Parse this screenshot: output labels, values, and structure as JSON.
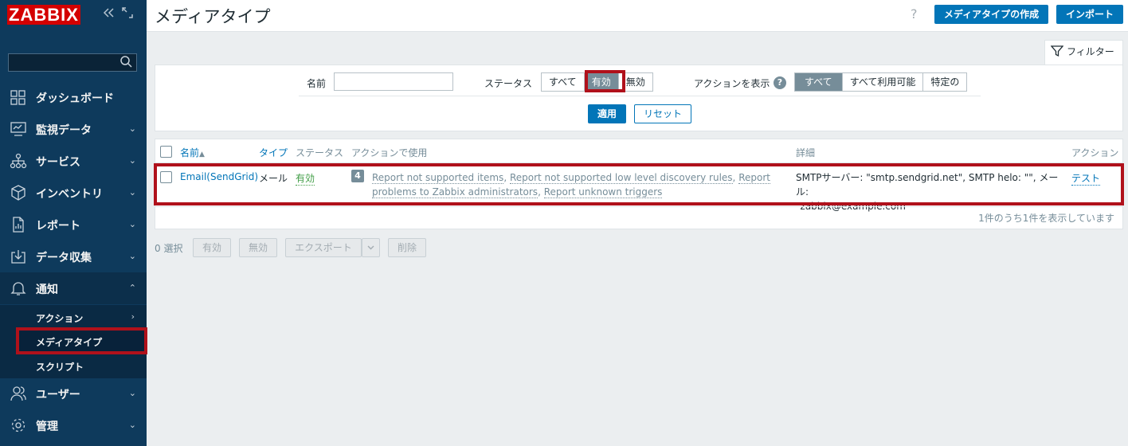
{
  "app": {
    "logo": "ZABBIX"
  },
  "sidebar": {
    "items": [
      {
        "label": "ダッシュボード",
        "icon": "dashboard-icon"
      },
      {
        "label": "監視データ",
        "icon": "monitoring-icon"
      },
      {
        "label": "サービス",
        "icon": "services-icon"
      },
      {
        "label": "インベントリ",
        "icon": "inventory-icon"
      },
      {
        "label": "レポート",
        "icon": "reports-icon"
      },
      {
        "label": "データ収集",
        "icon": "data-collection-icon"
      },
      {
        "label": "通知",
        "icon": "bell-icon"
      },
      {
        "label": "ユーザー",
        "icon": "users-icon"
      },
      {
        "label": "管理",
        "icon": "gear-icon"
      }
    ],
    "submenu": [
      {
        "label": "アクション"
      },
      {
        "label": "メディアタイプ"
      },
      {
        "label": "スクリプト"
      }
    ]
  },
  "header": {
    "title": "メディアタイプ",
    "help": "?",
    "create_label": "メディアタイプの作成",
    "import_label": "インポート"
  },
  "filter": {
    "tab_label": "フィルター",
    "name_label": "名前",
    "name_value": "",
    "status_label": "ステータス",
    "status_options": [
      "すべて",
      "有効",
      "無効"
    ],
    "status_selected": "有効",
    "actions_label": "アクションを表示",
    "actions_help": "?",
    "actions_options": [
      "すべて",
      "すべて利用可能",
      "特定の"
    ],
    "actions_selected": "すべて",
    "apply_label": "適用",
    "reset_label": "リセット"
  },
  "table": {
    "columns": {
      "name": "名前",
      "sort_arrow": "▲",
      "type": "タイプ",
      "status": "ステータス",
      "used_in_actions": "アクションで使用",
      "details": "詳細",
      "actions": "アクション"
    },
    "rows": [
      {
        "name": "Email(SendGrid)",
        "type": "メール",
        "status": "有効",
        "action_count": "4",
        "actions": [
          "Report not supported items",
          "Report not supported low level discovery rules",
          "Report problems to Zabbix administrators",
          "Report unknown triggers"
        ],
        "details_line1": "SMTPサーバー: \"smtp.sendgrid.net\", SMTP helo: \"\", メール:",
        "details_line2": "\"zabbix@example.com\"",
        "test_label": "テスト"
      }
    ],
    "footer": "1件のうち1件を表示しています"
  },
  "bottom_bar": {
    "selected": "0 選択",
    "enable_label": "有効",
    "disable_label": "無効",
    "export_label": "エクスポート",
    "delete_label": "削除"
  },
  "colors": {
    "sidebar_bg": "#0e3a5c",
    "primary": "#0275b8",
    "highlight_box": "#b0111b",
    "enabled_green": "#429e47",
    "selected_segment": "#768d99"
  }
}
